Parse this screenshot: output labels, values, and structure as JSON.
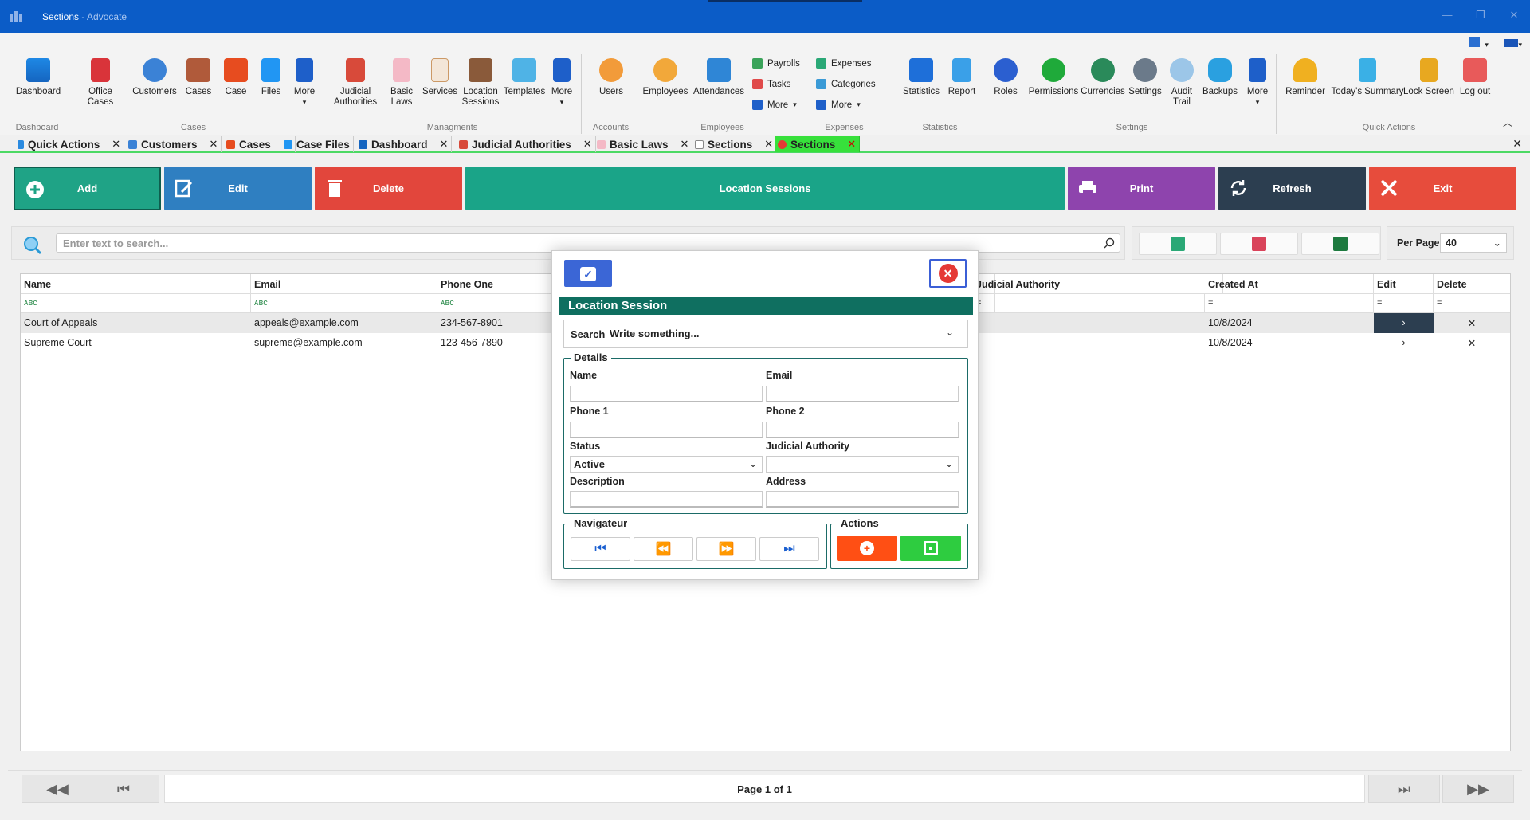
{
  "window": {
    "title": "Sections",
    "app": "Advocate",
    "separator": " - "
  },
  "ribbon": {
    "groups": [
      {
        "label": "Dashboard"
      },
      {
        "label": "Cases"
      },
      {
        "label": "Managments"
      },
      {
        "label": "Accounts"
      },
      {
        "label": "Employees"
      },
      {
        "label": "Expenses"
      },
      {
        "label": "Statistics"
      },
      {
        "label": "Settings"
      },
      {
        "label": "Quick Actions"
      }
    ],
    "buttons": {
      "dashboard": "Dashboard",
      "office_cases": "Office Cases",
      "customers": "Customers",
      "cases": "Cases",
      "case": "Case",
      "files": "Files",
      "more_cases": "More",
      "judicial_authorities": "Judicial\nAuthorities",
      "basic_laws": "Basic\nLaws",
      "services": "Services",
      "location_sessions": "Location\nSessions",
      "templates": "Templates",
      "more_managments": "More",
      "users": "Users",
      "employees": "Employees",
      "attendances": "Attendances",
      "payrolls": "Payrolls",
      "tasks": "Tasks",
      "more_employees": "More",
      "expenses": "Expenses",
      "categories": "Categories",
      "more_expenses": "More",
      "statistics": "Statistics",
      "report": "Report",
      "roles": "Roles",
      "permissions": "Permissions",
      "currencies": "Currencies",
      "settings": "Settings",
      "audit_trail": "Audit\nTrail",
      "backups": "Backups",
      "more_settings": "More",
      "reminder": "Reminder",
      "todays_summary": "Today's Summary",
      "lock_screen": "Lock Screen",
      "log_out": "Log out"
    }
  },
  "tabs": [
    {
      "label": "Quick Actions"
    },
    {
      "label": "Customers"
    },
    {
      "label": "Cases"
    },
    {
      "label": "Case Files"
    },
    {
      "label": "Dashboard"
    },
    {
      "label": "Judicial Authorities"
    },
    {
      "label": "Basic Laws"
    },
    {
      "label": "Sections"
    },
    {
      "label": "Sections",
      "active": true
    }
  ],
  "toolbar": {
    "add": "Add",
    "edit": "Edit",
    "delete": "Delete",
    "location_sessions": "Location Sessions",
    "print": "Print",
    "refresh": "Refresh",
    "exit": "Exit"
  },
  "search": {
    "placeholder": "Enter text to search..."
  },
  "per_page": {
    "label": "Per Page",
    "value": "40"
  },
  "grid": {
    "columns": [
      "Name",
      "Email",
      "Phone One",
      "Judicial Authority",
      "Created At",
      "Edit",
      "Delete"
    ],
    "rows": [
      {
        "name": "Court of Appeals",
        "email": "appeals@example.com",
        "phone": "234-567-8901",
        "created": "10/8/2024"
      },
      {
        "name": "Supreme Court",
        "email": "supreme@example.com",
        "phone": "123-456-7890",
        "created": "10/8/2024"
      }
    ]
  },
  "pager": {
    "text": "Page 1 of 1"
  },
  "dialog": {
    "title": "Location Session",
    "search_label": "Search",
    "search_value": "Write something...",
    "details_legend": "Details",
    "labels": {
      "name": "Name",
      "email": "Email",
      "phone1": "Phone 1",
      "phone2": "Phone 2",
      "status": "Status",
      "judicial_authority": "Judicial Authority",
      "description": "Description",
      "address": "Address"
    },
    "status_value": "Active",
    "navigator_legend": "Navigateur",
    "actions_legend": "Actions"
  },
  "colors": {
    "titlebar": "#0b5cc7",
    "add": "#1fa386",
    "edit": "#2f7fc1",
    "delete": "#e2463c",
    "location": "#1aa488",
    "print": "#8e44ad",
    "refresh": "#2c3e50",
    "exit": "#e74c3c",
    "dialog_title": "#0f6f60",
    "active_tab": "#37e03b"
  }
}
